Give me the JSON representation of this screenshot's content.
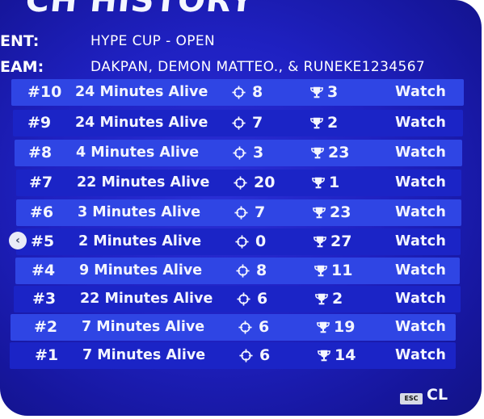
{
  "screen": {
    "title": "CH HISTORY",
    "event_label": "ENT:",
    "event_value": "HYPE CUP - OPEN",
    "team_label": "EAM:",
    "team_value": "DAKPAN, DEMON MATTEO., & RUNEKE1234567"
  },
  "icons": {
    "eliminations": "crosshair-icon",
    "placement": "trophy-icon",
    "back": "chevron-left-icon"
  },
  "matches": [
    {
      "rank": "#10",
      "alive": "24 Minutes Alive",
      "elims": "8",
      "place": "3",
      "action": "Watch"
    },
    {
      "rank": "#9",
      "alive": "24 Minutes Alive",
      "elims": "7",
      "place": "2",
      "action": "Watch"
    },
    {
      "rank": "#8",
      "alive": "4 Minutes Alive",
      "elims": "3",
      "place": "23",
      "action": "Watch"
    },
    {
      "rank": "#7",
      "alive": "22 Minutes Alive",
      "elims": "20",
      "place": "1",
      "action": "Watch"
    },
    {
      "rank": "#6",
      "alive": "3 Minutes Alive",
      "elims": "7",
      "place": "23",
      "action": "Watch"
    },
    {
      "rank": "#5",
      "alive": "2 Minutes Alive",
      "elims": "0",
      "place": "27",
      "action": "Watch"
    },
    {
      "rank": "#4",
      "alive": "9 Minutes Alive",
      "elims": "8",
      "place": "11",
      "action": "Watch"
    },
    {
      "rank": "#3",
      "alive": "22 Minutes Alive",
      "elims": "6",
      "place": "2",
      "action": "Watch"
    },
    {
      "rank": "#2",
      "alive": "7 Minutes Alive",
      "elims": "6",
      "place": "19",
      "action": "Watch"
    },
    {
      "rank": "#1",
      "alive": "7 Minutes Alive",
      "elims": "6",
      "place": "14",
      "action": "Watch"
    }
  ],
  "footer": {
    "esc_key": "ESC",
    "close_label": "CL"
  },
  "colors": {
    "background": "#1f21c2",
    "row_light": "#2f45e4",
    "row_dark": "#1b24c6",
    "text": "#f3f5ff"
  }
}
